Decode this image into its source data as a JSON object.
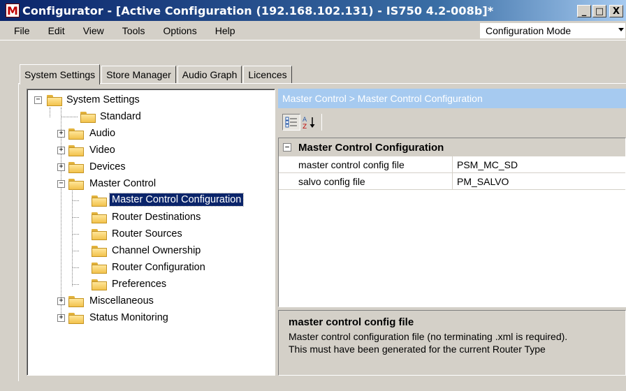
{
  "window": {
    "app_icon": "M",
    "title": "Configurator - [Active Configuration (192.168.102.131) - IS750 4.2-008b]*",
    "minimize": "_",
    "maximize": "□",
    "close": "X"
  },
  "menubar": {
    "items": [
      "File",
      "Edit",
      "View",
      "Tools",
      "Options",
      "Help"
    ],
    "mode_select": {
      "value": "Configuration Mode"
    }
  },
  "tabs": [
    "System Settings",
    "Store Manager",
    "Audio Graph",
    "Licences"
  ],
  "active_tab": "System Settings",
  "tree": {
    "root": "System Settings",
    "items": [
      {
        "label": "Standard",
        "expander": ""
      },
      {
        "label": "Audio",
        "expander": "+"
      },
      {
        "label": "Video",
        "expander": "+"
      },
      {
        "label": "Devices",
        "expander": "+"
      },
      {
        "label": "Master Control",
        "expander": "−"
      },
      {
        "label": "Master Control Configuration",
        "expander": "",
        "selected": true
      },
      {
        "label": "Router Destinations",
        "expander": ""
      },
      {
        "label": "Router Sources",
        "expander": ""
      },
      {
        "label": "Channel Ownership",
        "expander": ""
      },
      {
        "label": "Router Configuration",
        "expander": ""
      },
      {
        "label": "Preferences",
        "expander": ""
      },
      {
        "label": "Miscellaneous",
        "expander": "+"
      },
      {
        "label": "Status Monitoring",
        "expander": "+"
      }
    ],
    "root_expander": "−"
  },
  "breadcrumb": "Master Control > Master Control Configuration",
  "toolbar": {
    "categorized_icon": "categorized-icon",
    "sort_icon": "sort-az-icon",
    "az_top": "A",
    "az_bottom": "Z"
  },
  "property_grid": {
    "category": "Master Control Configuration",
    "category_expander": "−",
    "rows": [
      {
        "name": "master control config file",
        "value": "PSM_MC_SD"
      },
      {
        "name": "salvo config file",
        "value": "PM_SALVO"
      }
    ]
  },
  "help": {
    "title": "master control config file",
    "line1": "Master control configuration file (no terminating .xml is required).",
    "line2": "This must have been generated for the current Router Type"
  }
}
